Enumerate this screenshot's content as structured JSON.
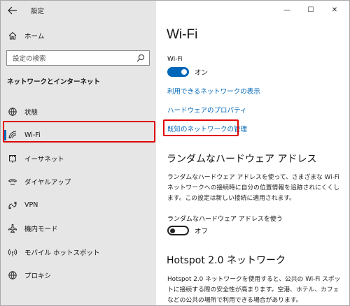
{
  "window": {
    "title": "設定",
    "controls": {
      "minimize": "—",
      "maximize": "☐",
      "close": "✕"
    }
  },
  "sidebar": {
    "back_icon": "back-arrow-icon",
    "home": {
      "label": "ホーム",
      "icon": "home-icon"
    },
    "search": {
      "placeholder": "設定の検索",
      "icon": "search-icon"
    },
    "section_title": "ネットワークとインターネット",
    "items": [
      {
        "label": "状態",
        "icon": "globe-status-icon",
        "active": false
      },
      {
        "label": "Wi-Fi",
        "icon": "wifi-icon",
        "active": true
      },
      {
        "label": "イーサネット",
        "icon": "ethernet-icon",
        "active": false
      },
      {
        "label": "ダイヤルアップ",
        "icon": "dialup-icon",
        "active": false
      },
      {
        "label": "VPN",
        "icon": "vpn-icon",
        "active": false
      },
      {
        "label": "機内モード",
        "icon": "airplane-icon",
        "active": false
      },
      {
        "label": "モバイル ホットスポット",
        "icon": "hotspot-icon",
        "active": false
      },
      {
        "label": "プロキシ",
        "icon": "globe-icon",
        "active": false
      }
    ]
  },
  "main": {
    "title": "Wi-Fi",
    "wifi_label": "Wi-Fi",
    "wifi_toggle": {
      "state": "on",
      "text": "オン"
    },
    "links": {
      "available_networks": "利用できるネットワークの表示",
      "hardware_properties": "ハードウェアのプロパティ",
      "manage_known": "既知のネットワークの管理"
    },
    "random_hw": {
      "heading": "ランダムなハードウェア アドレス",
      "description": "ランダムなハードウェア アドレスを使って、さまざまな Wi-Fi ネットワークへの接続時に自分の位置情報を追跡されにくくします。この設定は新しい接続に適用されます。",
      "toggle_label": "ランダムなハードウェア アドレスを使う",
      "toggle_state": "off",
      "toggle_text": "オフ"
    },
    "hotspot": {
      "heading": "Hotspot 2.0 ネットワーク",
      "description": "Hotspot 2.0 ネットワークを使用すると、公共の Wi-Fi スポットに接続する際の安全性が高まります。空港、ホテル、カフェなどの公共の場所で利用できる場合があります。"
    }
  },
  "colors": {
    "accent": "#0067b8",
    "highlight": "#e00000",
    "sidebar_bg": "#e6e6e6"
  }
}
